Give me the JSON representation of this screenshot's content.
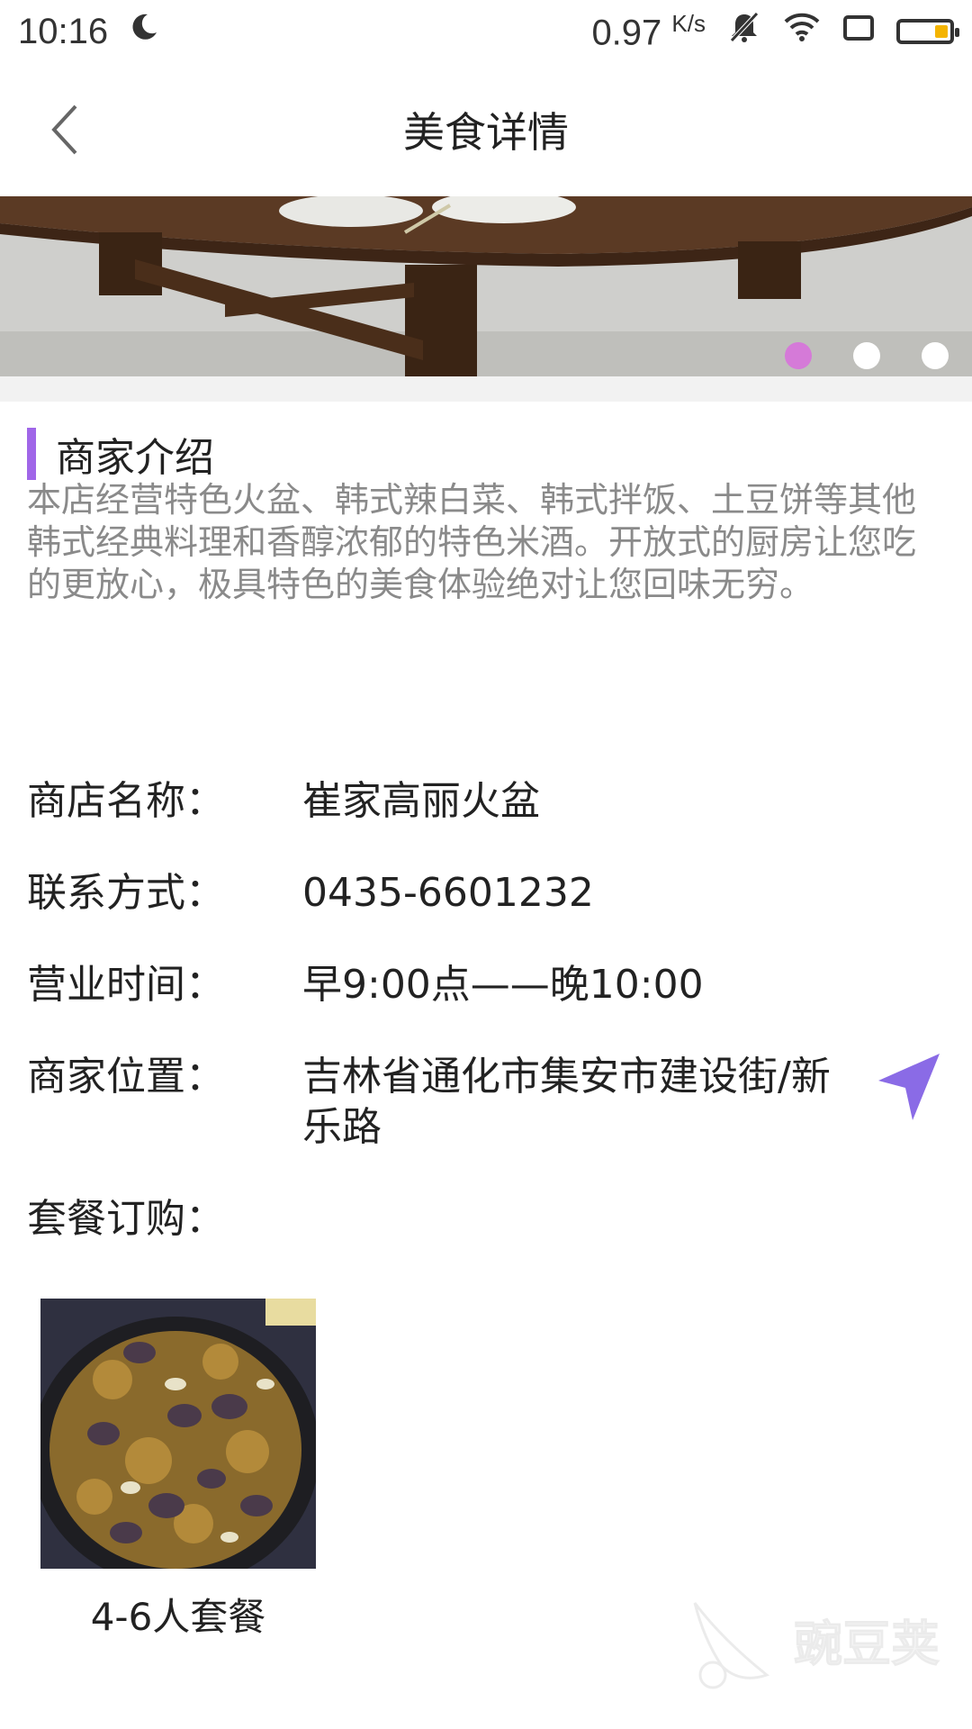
{
  "status_bar": {
    "time": "10:16",
    "speed": "0.97",
    "speed_unit": "K/s"
  },
  "header": {
    "title": "美食详情"
  },
  "banner": {
    "slide_count": 3,
    "active_index": 0,
    "active_dot_color": "#d57ad8"
  },
  "intro": {
    "title": "商家介绍",
    "text": "本店经营特色火盆、韩式辣白菜、韩式拌饭、土豆饼等其他韩式经典料理和香醇浓郁的特色米酒。开放式的厨房让您吃的更放心，极具特色的美食体验绝对让您回味无穷。",
    "accent_color": "#a066e8"
  },
  "info": {
    "name_label": "商店名称：",
    "name_value": "崔家高丽火盆",
    "phone_label": "联系方式：",
    "phone_value": "0435-6601232",
    "hours_label": "营业时间：",
    "hours_value": "早9:00点——晚10:00",
    "address_label": "商家位置：",
    "address_value": "吉林省通化市集安市建设街/新乐路",
    "package_label": "套餐订购："
  },
  "packages": [
    {
      "label": "4-6人套餐"
    }
  ],
  "watermark": {
    "text": "豌豆荚"
  },
  "colors": {
    "accent": "#a066e8",
    "nav_icon": "#8a6be6"
  }
}
